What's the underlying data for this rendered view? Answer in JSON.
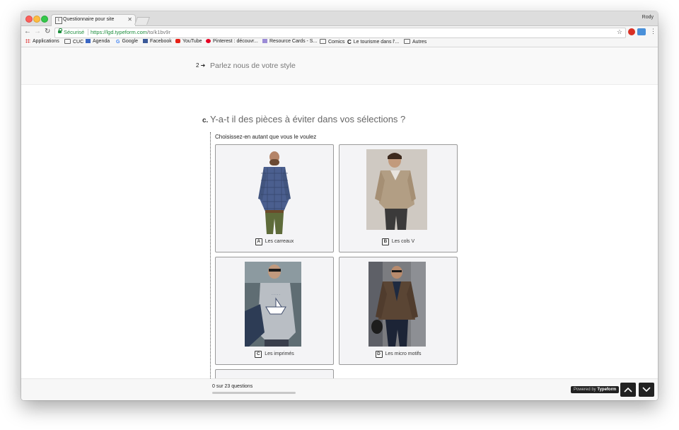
{
  "browser": {
    "tab_title": "Questionnaire pour site",
    "tab_favicon": "t",
    "profile_name": "Rody",
    "secure_label": "Sécurisé",
    "url_host": "https://lgd.typeform.com",
    "url_path": "/to/k1bv9r",
    "bookmarks": [
      "Applications",
      "CUC",
      "Agenda",
      "Google",
      "Facebook",
      "YouTube",
      "Pinterest : découvr...",
      "Resource Cards - S...",
      "Comics",
      "Le tourisme dans l'...",
      "Autres"
    ]
  },
  "form": {
    "previous_number": "2",
    "previous_question": "Parlez nous de votre style",
    "question_letter": "c.",
    "question_text": "Y-a-t il des pièces à éviter dans vos sélections ?",
    "hint": "Choisissez-en autant que vous le voulez",
    "choices": [
      {
        "key": "A",
        "label": "Les carreaux"
      },
      {
        "key": "B",
        "label": "Les cols V"
      },
      {
        "key": "C",
        "label": "Les imprimés"
      },
      {
        "key": "D",
        "label": "Les micro motifs"
      }
    ]
  },
  "footer": {
    "progress_text": "0 sur 23 questions",
    "progress_fraction": 0.0,
    "powered_prefix": "Powered by",
    "powered_brand": "Typeform"
  },
  "icons": [
    "back-arrow-icon",
    "forward-arrow-icon",
    "reload-icon",
    "lock-icon",
    "star-icon",
    "menu-icon",
    "chevron-up-icon",
    "chevron-down-icon"
  ]
}
